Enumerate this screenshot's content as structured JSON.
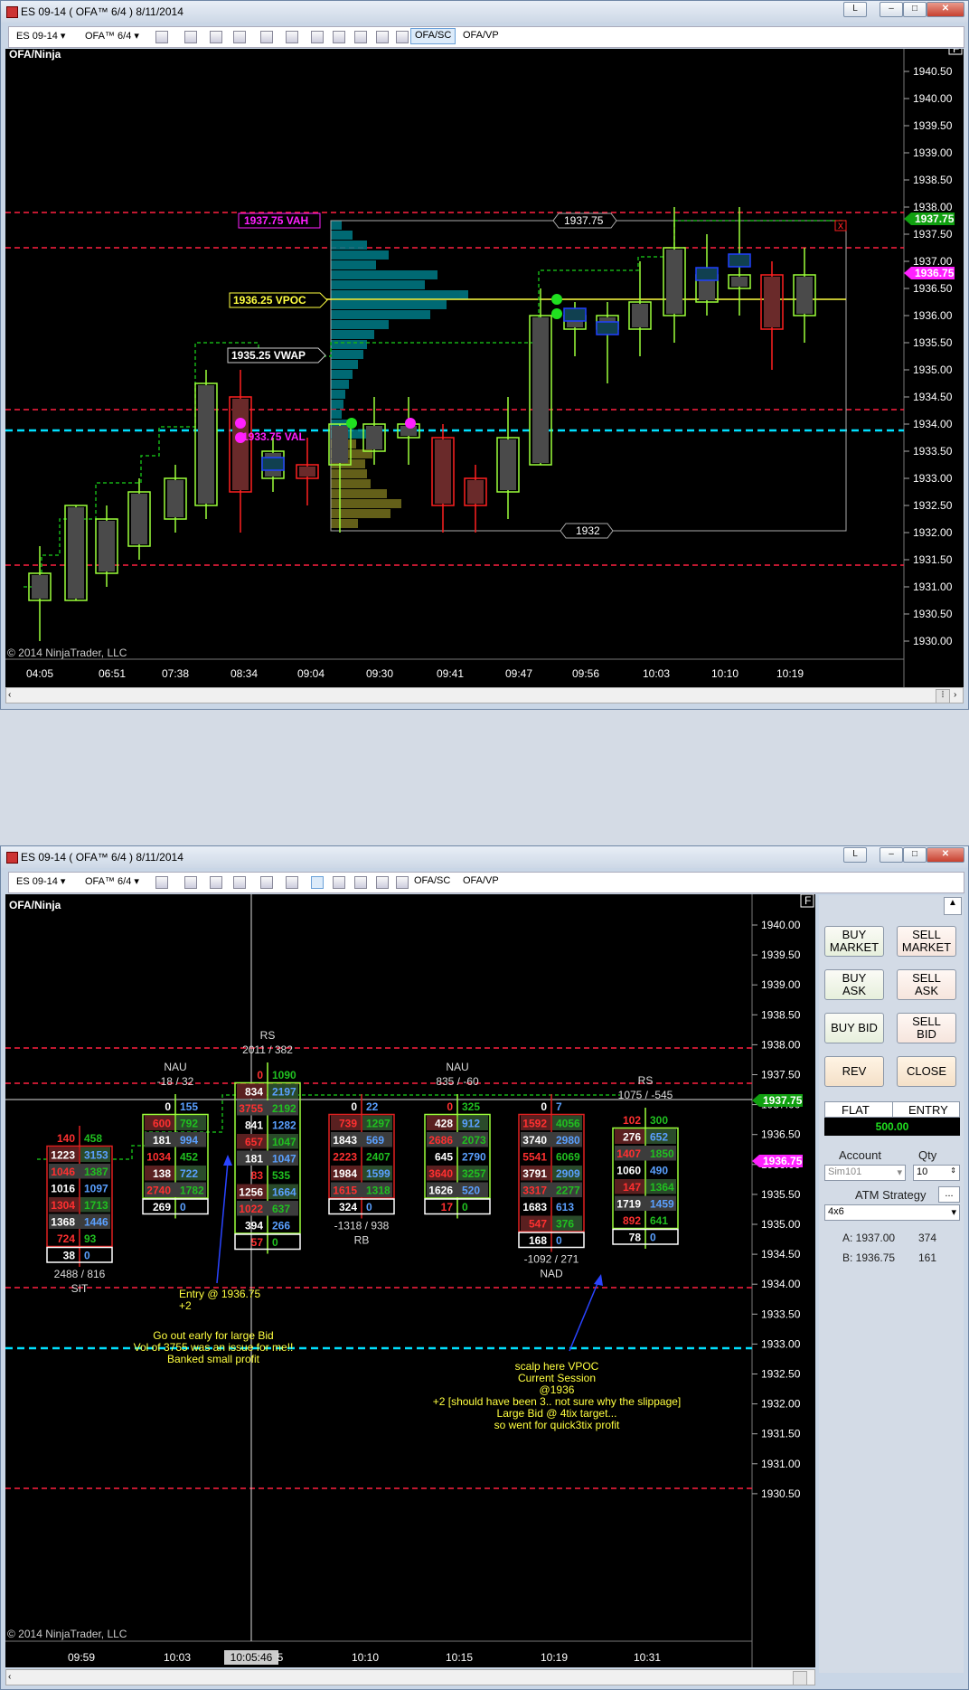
{
  "top_window": {
    "title": "ES 09-14 ( OFA™ 6/4 )  8/11/2014",
    "window_buttons": {
      "pin": "L",
      "minimize": "–",
      "restore": "□",
      "close": "✕"
    },
    "toolbar": {
      "instrument": "ES 09-14",
      "template": "OFA™ 6/4",
      "tab_sc": "OFA/SC",
      "tab_vp": "OFA/VP"
    },
    "chart_label": "OFA/Ninja",
    "copyright": "© 2014 NinjaTrader, LLC",
    "f_button": "F",
    "price_axis": [
      "1940.50",
      "1940.00",
      "1939.50",
      "1939.00",
      "1938.50",
      "1938.00",
      "1937.50",
      "1937.00",
      "1936.50",
      "1936.00",
      "1935.50",
      "1935.00",
      "1934.50",
      "1934.00",
      "1933.50",
      "1933.00",
      "1932.50",
      "1932.00",
      "1931.50",
      "1931.00",
      "1930.50",
      "1930.00"
    ],
    "time_axis": [
      "04:05",
      "06:51",
      "07:38",
      "08:34",
      "09:04",
      "09:30",
      "09:41",
      "09:47",
      "09:56",
      "10:03",
      "10:10",
      "10:19"
    ],
    "price_marker_green": "1937.75",
    "price_marker_magenta": "1936.75",
    "labels": {
      "vah": "1937.75 VAH",
      "vpoc": "1936.25 VPOC",
      "vwap": "1935.25 VWAP",
      "val": "1933.75 VAL",
      "range_high": "1937.75",
      "range_low": "1932",
      "x_marker": "x"
    }
  },
  "bottom_window": {
    "title": "ES 09-14 ( OFA™ 6/4 )  8/11/2014",
    "toolbar": {
      "instrument": "ES 09-14",
      "template": "OFA™ 6/4",
      "tab_sc": "OFA/SC",
      "tab_vp": "OFA/VP"
    },
    "chart_label": "OFA/Ninja",
    "copyright": "© 2014 NinjaTrader, LLC",
    "f_button": "F",
    "price_axis": [
      "1940.00",
      "1939.50",
      "1939.00",
      "1938.50",
      "1938.00",
      "1937.50",
      "1937.00",
      "1936.50",
      "1936.00",
      "1935.50",
      "1935.00",
      "1934.50",
      "1934.00",
      "1933.50",
      "1933.00",
      "1932.50",
      "1932.00",
      "1931.50",
      "1931.00",
      "1930.50"
    ],
    "time_axis": [
      "09:59",
      "10:03",
      "10:05:46",
      "5",
      "10:10",
      "10:15",
      "10:19",
      "10:31"
    ],
    "price_marker_green": "1937.75",
    "price_marker_magenta": "1936.75",
    "bars": [
      {
        "title": "",
        "subtitle": "",
        "rows": [
          [
            "140",
            "458"
          ],
          [
            "1223",
            "3153"
          ],
          [
            "1046",
            "1387"
          ],
          [
            "1016",
            "1097"
          ],
          [
            "1304",
            "1713"
          ],
          [
            "1368",
            "1446"
          ],
          [
            "724",
            "93"
          ],
          [
            "38",
            "0"
          ]
        ],
        "footer": "2488 / 816",
        "tag": "SIT"
      },
      {
        "title": "NAU",
        "subtitle": "-18 / 32",
        "rows": [
          [
            "0",
            "155"
          ],
          [
            "600",
            "792"
          ],
          [
            "181",
            "994"
          ],
          [
            "1034",
            "452"
          ],
          [
            "138",
            "722"
          ],
          [
            "2740",
            "1782"
          ],
          [
            "269",
            "0"
          ]
        ],
        "footer": "",
        "tag": ""
      },
      {
        "title": "RS",
        "subtitle": "2011 / 382",
        "rows": [
          [
            "0",
            "1090"
          ],
          [
            "834",
            "2197"
          ],
          [
            "3755",
            "2192"
          ],
          [
            "841",
            "1282"
          ],
          [
            "657",
            "1047"
          ],
          [
            "181",
            "1047"
          ],
          [
            "83",
            "535"
          ],
          [
            "1256",
            "1664"
          ],
          [
            "1022",
            "637"
          ],
          [
            "394",
            "266"
          ],
          [
            "57",
            "0"
          ]
        ],
        "footer": "",
        "tag": ""
      },
      {
        "title": "",
        "subtitle": "",
        "rows": [
          [
            "0",
            "22"
          ],
          [
            "739",
            "1297"
          ],
          [
            "1843",
            "569"
          ],
          [
            "2223",
            "2407"
          ],
          [
            "1984",
            "1599"
          ],
          [
            "1615",
            "1318"
          ],
          [
            "324",
            "0"
          ]
        ],
        "footer": "-1318 / 938",
        "tag": "RB"
      },
      {
        "title": "NAU",
        "subtitle": "835 / -60",
        "rows": [
          [
            "0",
            "325"
          ],
          [
            "428",
            "912"
          ],
          [
            "2686",
            "2073"
          ],
          [
            "645",
            "2790"
          ],
          [
            "3640",
            "3257"
          ],
          [
            "1626",
            "520"
          ],
          [
            "17",
            "0"
          ]
        ],
        "footer": "",
        "tag": ""
      },
      {
        "title": "",
        "subtitle": "",
        "rows": [
          [
            "0",
            "7"
          ],
          [
            "1592",
            "4056"
          ],
          [
            "3740",
            "2980"
          ],
          [
            "5541",
            "6069"
          ],
          [
            "3791",
            "2909"
          ],
          [
            "3317",
            "2277"
          ],
          [
            "1683",
            "613"
          ],
          [
            "547",
            "376"
          ],
          [
            "168",
            "0"
          ]
        ],
        "footer": "-1092 / 271",
        "tag": "NAD"
      },
      {
        "title": "RS",
        "subtitle": "1075 / -545",
        "rows": [
          [
            "102",
            "300"
          ],
          [
            "276",
            "652"
          ],
          [
            "1407",
            "1850"
          ],
          [
            "1060",
            "490"
          ],
          [
            "147",
            "1364"
          ],
          [
            "1719",
            "1459"
          ],
          [
            "892",
            "641"
          ],
          [
            "78",
            "0"
          ]
        ],
        "footer": "",
        "tag": ""
      }
    ],
    "annotations": {
      "entry": "Entry @ 1936.75\n+2",
      "note1": "Go out early for large Bid\nVol of 3755 was an issue for me!!\nBanked small profit",
      "note2": "scalp here VPOC\nCurrent Session\n@1936\n+2 [should have been 3.. not sure why the slippage]\nLarge Bid @ 4tix target...\nso went for quick3tix profit"
    }
  },
  "order_panel": {
    "buy_market": "BUY\nMARKET",
    "sell_market": "SELL\nMARKET",
    "buy_ask": "BUY\nASK",
    "sell_ask": "SELL\nASK",
    "buy_bid": "BUY BID",
    "sell_bid": "SELL\nBID",
    "rev": "REV",
    "close": "CLOSE",
    "flat": "FLAT",
    "entry": "ENTRY",
    "pnl": "500.00",
    "account_label": "Account",
    "qty_label": "Qty",
    "account_value": "Sim101",
    "qty_value": "10",
    "atm_label": "ATM Strategy",
    "atm_more": "...",
    "atm_value": "4x6",
    "ask_label": "A: 1937.00",
    "ask_size": "374",
    "bid_label": "B: 1936.75",
    "bid_size": "161"
  },
  "colors": {
    "chart_bg": "#000000",
    "up_candle": "#9cff3a",
    "down_candle": "#ff2020",
    "vp_cyan": "#00d8e8",
    "magenta": "#ff20ff",
    "vpoc_yellow": "#ffff40",
    "dash_red": "#ff2040",
    "dash_cyan": "#00e0ff"
  }
}
